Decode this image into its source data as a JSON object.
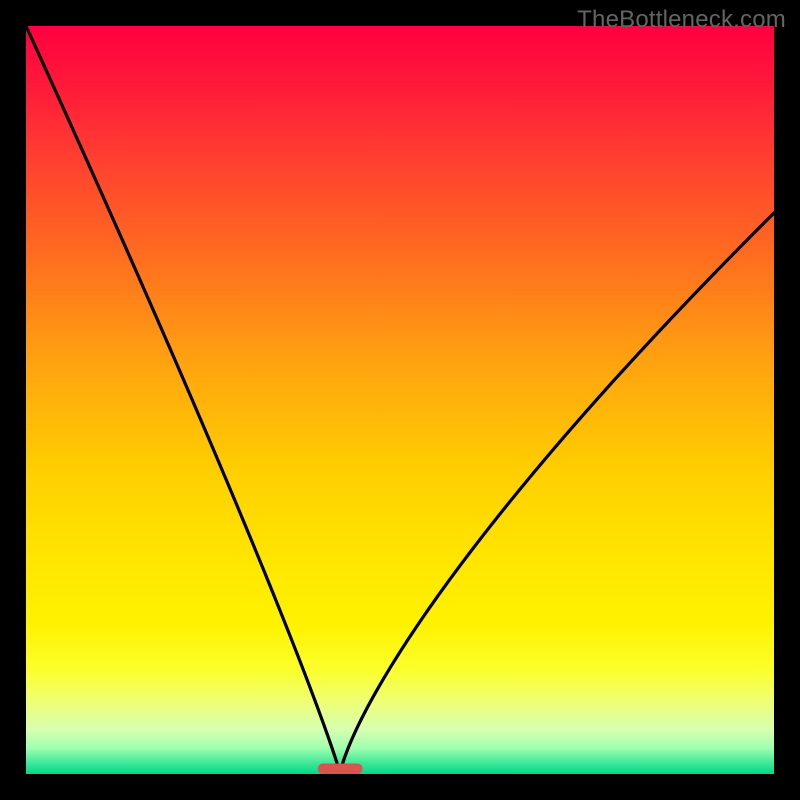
{
  "watermark": "TheBottleneck.com",
  "colors": {
    "black": "#000000",
    "curve": "#000000",
    "marker_fill": "#d9534f",
    "gradient_stops": [
      {
        "offset": 0.0,
        "color": "#ff0040"
      },
      {
        "offset": 0.08,
        "color": "#ff1a3a"
      },
      {
        "offset": 0.18,
        "color": "#ff4030"
      },
      {
        "offset": 0.3,
        "color": "#ff6a20"
      },
      {
        "offset": 0.45,
        "color": "#ffa310"
      },
      {
        "offset": 0.6,
        "color": "#ffd000"
      },
      {
        "offset": 0.72,
        "color": "#ffe700"
      },
      {
        "offset": 0.8,
        "color": "#fff200"
      },
      {
        "offset": 0.86,
        "color": "#fbff2a"
      },
      {
        "offset": 0.9,
        "color": "#f0ff70"
      },
      {
        "offset": 0.94,
        "color": "#d8ffb0"
      },
      {
        "offset": 0.965,
        "color": "#a0ffb0"
      },
      {
        "offset": 0.985,
        "color": "#40e89a"
      },
      {
        "offset": 1.0,
        "color": "#00d884"
      }
    ]
  },
  "chart_data": {
    "type": "line",
    "title": "",
    "xlabel": "",
    "ylabel": "",
    "xlim": [
      0,
      100
    ],
    "ylim": [
      0,
      100
    ],
    "grid": false,
    "notes": "V-shaped bottleneck curve. y ≈ 100·|x−42|/42 for x≤42 (left branch hits top at x≈0); right branch rises more slowly, y ≈ 100·((x−42)/58)^0.77, reaching ~75 at x=100. Minimum (0) at x≈42. Background is a vertical heat gradient from red (top, high bottleneck) through orange/yellow to green (bottom, no bottleneck). Marker at the minimum.",
    "series": [
      {
        "name": "bottleneck-curve",
        "min_x": 42,
        "left": {
          "x": [
            0,
            5,
            10,
            15,
            20,
            25,
            30,
            35,
            40,
            42
          ],
          "y": [
            100,
            88,
            76,
            64,
            52,
            40,
            29,
            17,
            5,
            0
          ]
        },
        "right": {
          "x": [
            42,
            45,
            50,
            55,
            60,
            65,
            70,
            75,
            80,
            85,
            90,
            95,
            100
          ],
          "y": [
            0,
            8,
            17,
            25,
            32,
            39,
            45,
            51,
            57,
            62,
            67,
            71,
            75
          ]
        }
      }
    ],
    "marker": {
      "x": 42,
      "y": 0,
      "w": 6,
      "h": 1.4
    }
  }
}
